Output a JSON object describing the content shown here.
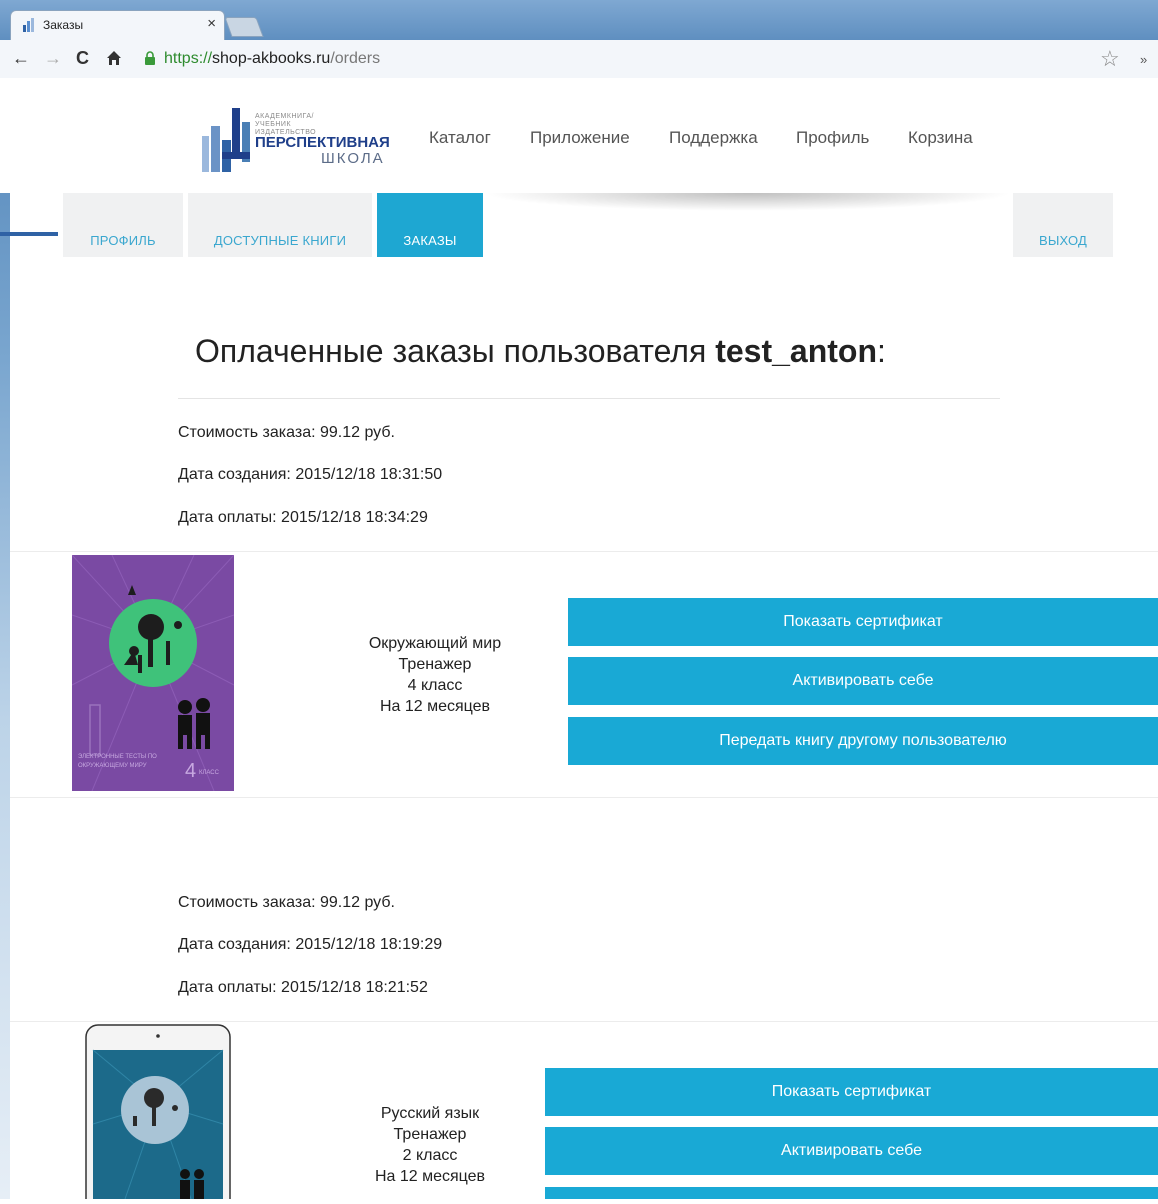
{
  "browser": {
    "tab_title": "Заказы",
    "url_scheme": "https://",
    "url_host": "shop-akbooks.ru",
    "url_path": "/orders"
  },
  "logo": {
    "publisher": "АКАДЕМКНИГА/УЧЕБНИК ИЗДАТЕЛЬСТВО",
    "line1": "ПЕРСПЕКТИВНАЯ",
    "line2": "ШКОЛА"
  },
  "menu": [
    "Каталог",
    "Приложение",
    "Поддержка",
    "Профиль",
    "Корзина"
  ],
  "tabs": {
    "profile": "ПРОФИЛЬ",
    "books": "ДОСТУПНЫЕ КНИГИ",
    "orders": "ЗАКАЗЫ",
    "logout": "ВЫХОД"
  },
  "page": {
    "title_prefix": "Оплаченные заказы пользователя ",
    "username": "test_anton",
    "title_suffix": ":"
  },
  "orders": [
    {
      "cost": "Стоимость заказа: 99.12 руб.",
      "created": "Дата создания: 2015/12/18 18:31:50",
      "paid": "Дата оплаты: 2015/12/18 18:34:29",
      "book": {
        "subject": "Окружающий мир",
        "type": "Тренажер",
        "grade": "4 класс",
        "term": "На 12 месяцев",
        "cover_caption": "ЭЛЕКТРОННЫЕ ТЕСТЫ ПО ОКРУЖАЮЩЕМУ МИРУ",
        "cover_grade": "4",
        "cover_grade_word": "КЛАСС"
      },
      "buttons": [
        "Показать сертификат",
        "Активировать себе",
        "Передать книгу другому пользователю"
      ]
    },
    {
      "cost": "Стоимость заказа: 99.12 руб.",
      "created": "Дата создания: 2015/12/18 18:19:29",
      "paid": "Дата оплаты: 2015/12/18 18:21:52",
      "book": {
        "subject": "Русский язык",
        "type": "Тренажер",
        "grade": "2 класс",
        "term": "На 12 месяцев"
      },
      "buttons": [
        "Показать сертификат",
        "Активировать себе"
      ]
    }
  ],
  "colors": {
    "accent": "#1ea7d2",
    "button": "#19a9d5",
    "cover_purple": "#7a4aa3",
    "cover_green": "#3fc27a",
    "cover_teal": "#1c6a8a"
  }
}
